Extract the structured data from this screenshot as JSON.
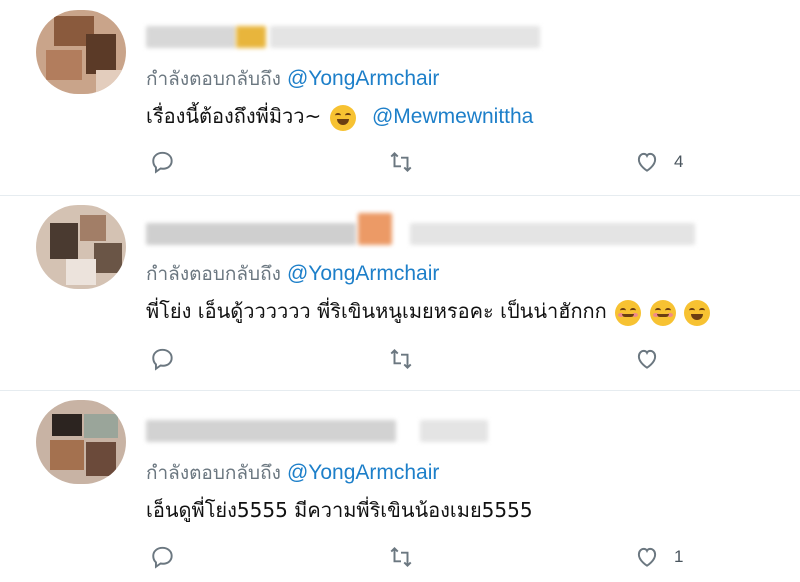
{
  "replies": [
    {
      "replying_to_prefix": "กำลังตอบกลับถึง",
      "replying_to_handle": "@YongArmchair",
      "text": "เรื่องนี้ต้องถึงพี่มิวว~",
      "emojis": [
        "face-with-tears-of-joy"
      ],
      "mention": "@Mewmewnittha",
      "like_count": "4"
    },
    {
      "replying_to_prefix": "กำลังตอบกลับถึง",
      "replying_to_handle": "@YongArmchair",
      "text": "พี่โย่ง เอ็นดู้วววววว พี่ริเขินหนูเมยหรอคะ เป็นน่าฮักกก",
      "emojis": [
        "smiling-face-with-blush",
        "smiling-face-with-blush",
        "grinning-squinting-face"
      ],
      "mention": "",
      "like_count": ""
    },
    {
      "replying_to_prefix": "กำลังตอบกลับถึง",
      "replying_to_handle": "@YongArmchair",
      "text": "เอ็นดูพี่โย่ง5555 มีความพี่ริเขินน้องเมย5555",
      "emojis": [],
      "mention": "",
      "like_count": "1"
    }
  ],
  "colors": {
    "mention": "#1d7fc9",
    "secondary_text": "#6b7780",
    "divider": "#e6ecf0"
  }
}
